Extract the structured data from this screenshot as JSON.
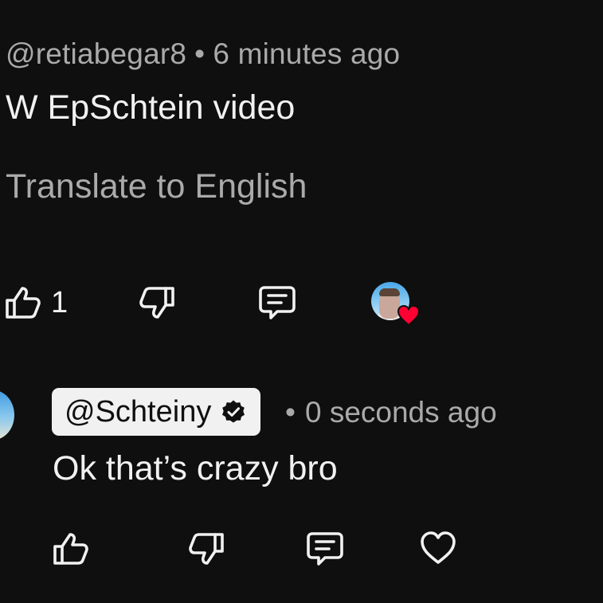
{
  "comment_1": {
    "author": "@retiabegar8",
    "separator": "•",
    "time": "6 minutes ago",
    "text": "W EpSchtein video",
    "translate_label": "Translate to English",
    "like_count": "1",
    "creator_hearted": true,
    "heart_color": "#ff0033"
  },
  "comment_2": {
    "author": "@Schteiny",
    "author_verified": true,
    "separator": "•",
    "time": "0 seconds ago",
    "text": "Ok that’s crazy bro"
  },
  "icons": {
    "like": "thumbs-up-icon",
    "dislike": "thumbs-down-icon",
    "reply": "comment-icon",
    "heart": "heart-icon",
    "verified": "verified-check-icon"
  },
  "colors": {
    "background": "#0f0f0f",
    "primary_text": "#f1f1f1",
    "secondary_text": "#aaaaaa",
    "chip_background": "#f1f1f1"
  }
}
